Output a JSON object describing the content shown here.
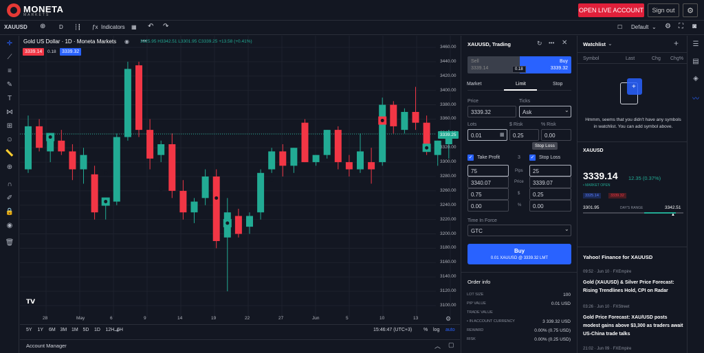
{
  "header": {
    "brand": "MONETA",
    "brand_sub": "MARKETS",
    "open_account": "OPEN LIVE ACCOUNT",
    "sign_out": "Sign out"
  },
  "toolbar": {
    "symbol": "XAUUSD",
    "interval": "D",
    "indicators": "Indicators",
    "layout": "Default"
  },
  "chart": {
    "title": "Gold US Dollar · 1D · Moneta Markets",
    "ohlc": "3325.95 H3342.51 L3301.95 C3339.25 +13.58 (+0.41%)",
    "sell_badge": "3339.14",
    "spread_badge": "0.18",
    "buy_badge": "3339.32",
    "price_tag": "3339.25",
    "xticks": [
      "28",
      "May",
      "6",
      "9",
      "14",
      "19",
      "22",
      "27",
      "Jun",
      "5",
      "10",
      "13"
    ],
    "ranges": [
      "5Y",
      "1Y",
      "6M",
      "3M",
      "1M",
      "5D",
      "1D",
      "12H",
      "6H"
    ],
    "time": "15:46:47 (UTC+3)",
    "pct": "%",
    "log": "log",
    "auto": "auto",
    "account_manager": "Account Manager"
  },
  "chart_data": {
    "type": "candlestick",
    "title": "Gold US Dollar · 1D · Moneta Markets",
    "ylim": [
      3100,
      3460
    ],
    "yticks": [
      "3460.00",
      "3440.00",
      "3420.00",
      "3400.00",
      "3380.00",
      "3360.00",
      "3340.00",
      "3320.00",
      "3300.00",
      "3280.00",
      "3260.00",
      "3240.00",
      "3220.00",
      "3200.00",
      "3180.00",
      "3160.00",
      "3140.00",
      "3120.00",
      "3100.00"
    ],
    "candles": [
      {
        "o": 3290,
        "h": 3365,
        "l": 3285,
        "c": 3350
      },
      {
        "o": 3350,
        "h": 3360,
        "l": 3315,
        "c": 3320
      },
      {
        "o": 3315,
        "h": 3335,
        "l": 3300,
        "c": 3330
      },
      {
        "o": 3330,
        "h": 3345,
        "l": 3310,
        "c": 3315
      },
      {
        "o": 3315,
        "h": 3325,
        "l": 3275,
        "c": 3290
      },
      {
        "o": 3290,
        "h": 3320,
        "l": 3270,
        "c": 3310
      },
      {
        "o": 3283,
        "h": 3295,
        "l": 3220,
        "c": 3230
      },
      {
        "o": 3240,
        "h": 3250,
        "l": 3220,
        "c": 3245
      },
      {
        "o": 3245,
        "h": 3340,
        "l": 3240,
        "c": 3335
      },
      {
        "o": 3335,
        "h": 3440,
        "l": 3330,
        "c": 3430
      },
      {
        "o": 3435,
        "h": 3440,
        "l": 3335,
        "c": 3345
      },
      {
        "o": 3345,
        "h": 3360,
        "l": 3290,
        "c": 3305
      },
      {
        "o": 3310,
        "h": 3330,
        "l": 3300,
        "c": 3325
      },
      {
        "o": 3325,
        "h": 3340,
        "l": 3250,
        "c": 3260
      },
      {
        "o": 3260,
        "h": 3275,
        "l": 3220,
        "c": 3230
      },
      {
        "o": 3230,
        "h": 3250,
        "l": 3215,
        "c": 3245
      },
      {
        "o": 3250,
        "h": 3290,
        "l": 3240,
        "c": 3280
      },
      {
        "o": 3280,
        "h": 3290,
        "l": 3180,
        "c": 3190
      },
      {
        "o": 3195,
        "h": 3250,
        "l": 3120,
        "c": 3230
      },
      {
        "o": 3225,
        "h": 3235,
        "l": 3195,
        "c": 3200
      },
      {
        "o": 3210,
        "h": 3230,
        "l": 3200,
        "c": 3225
      },
      {
        "o": 3230,
        "h": 3290,
        "l": 3220,
        "c": 3285
      },
      {
        "o": 3290,
        "h": 3320,
        "l": 3285,
        "c": 3315
      },
      {
        "o": 3315,
        "h": 3325,
        "l": 3280,
        "c": 3295
      },
      {
        "o": 3295,
        "h": 3320,
        "l": 3285,
        "c": 3320
      },
      {
        "o": 3355,
        "h": 3360,
        "l": 3300,
        "c": 3300
      },
      {
        "o": 3300,
        "h": 3310,
        "l": 3295,
        "c": 3310
      },
      {
        "o": 3310,
        "h": 3345,
        "l": 3305,
        "c": 3345
      },
      {
        "o": 3345,
        "h": 3350,
        "l": 3290,
        "c": 3300
      },
      {
        "o": 3300,
        "h": 3310,
        "l": 3280,
        "c": 3290
      },
      {
        "o": 3290,
        "h": 3340,
        "l": 3285,
        "c": 3315
      },
      {
        "o": 3300,
        "h": 3320,
        "l": 3270,
        "c": 3290
      },
      {
        "o": 3300,
        "h": 3390,
        "l": 3295,
        "c": 3380
      },
      {
        "o": 3380,
        "h": 3385,
        "l": 3340,
        "c": 3350
      },
      {
        "o": 3345,
        "h": 3375,
        "l": 3340,
        "c": 3370
      },
      {
        "o": 3370,
        "h": 3405,
        "l": 3345,
        "c": 3355
      },
      {
        "o": 3355,
        "h": 3365,
        "l": 3310,
        "c": 3315
      },
      {
        "o": 3310,
        "h": 3330,
        "l": 3295,
        "c": 3330
      },
      {
        "o": 3325,
        "h": 3345,
        "l": 3305,
        "c": 3339
      }
    ]
  },
  "trade": {
    "title": "XAUUSD, Trading",
    "sell_label": "Sell",
    "sell_price": "3339.14",
    "spread": "0.18",
    "buy_label": "Buy",
    "buy_price": "3339.32",
    "tabs": [
      "Market",
      "Limit",
      "Stop"
    ],
    "price_label": "Price",
    "ticks_label": "Ticks",
    "price_value": "3339.32",
    "ticks_value": "Ask",
    "lots_label": "Lots",
    "risk_label": "$ Risk",
    "pct_risk_label": "% Risk",
    "lots_value": "0.01",
    "risk_value": "0.25",
    "pct_risk_value": "0.00",
    "tooltip": "Stop Loss",
    "tp_label": "Take Profit",
    "sl_label": "Stop Loss",
    "mid_labels": [
      "Pips",
      "Price",
      "$",
      "%"
    ],
    "tp_values": [
      "75",
      "3340.07",
      "0.75",
      "0.00"
    ],
    "sl_values": [
      "25",
      "3339.07",
      "0.25",
      "0.00"
    ],
    "tif_label": "Time In Force",
    "tif_value": "GTC",
    "buy_button": "Buy",
    "buy_button_sub": "0.01 XAUUSD @ 3339.32 LMT",
    "order_info": "Order info",
    "info_rows": [
      {
        "k": "LOT SIZE",
        "v": "100"
      },
      {
        "k": "PIP VALUE",
        "v": "0.01 USD"
      },
      {
        "k": "TRADE VALUE",
        "v": ""
      },
      {
        "k": "• IN ACCOUNT CURRENCY",
        "v": "3 339.32 USD"
      },
      {
        "k": "REWARD",
        "v": "0.00% (0.75 USD)"
      },
      {
        "k": "RISK",
        "v": "0.00% (0.25 USD)"
      }
    ],
    "mid_3": "3"
  },
  "watchlist": {
    "title": "Watchlist",
    "cols": [
      "Symbol",
      "Last",
      "Chg",
      "Chg%"
    ],
    "empty_msg": "Hmmm, seems that you didn't have any symbols in watchlist. You can add symbol above.",
    "symbol": "XAUUSD",
    "price": "3339.14",
    "change": "12.35 (0.37%)",
    "market": "• MARKET OPEN",
    "badge_bid": "3325.14",
    "badge_ask": "3339.32",
    "low": "3301.95",
    "range_label": "DAY'S RANGE",
    "high": "3342.51",
    "news_title": "Yahoo! Finance for XAUUSD",
    "news": [
      {
        "meta": "09:52 · Jun 10 · FXEmpire",
        "text": "Gold (XAUUSD) & Silver Price Forecast: Rising Trendlines Hold, CPI on Radar"
      },
      {
        "meta": "03:26 · Jun 10 · FXStreet",
        "text": "Gold Price Forecast: XAU/USD posts modest gains above $3,300 as traders await US-China trade talks"
      },
      {
        "meta": "21:02 · Jun 09 · FXEmpire",
        "text": ""
      }
    ]
  },
  "colors": {
    "up": "#22ab94",
    "down": "#f23645",
    "accent": "#2962ff",
    "red": "#e0203a"
  }
}
